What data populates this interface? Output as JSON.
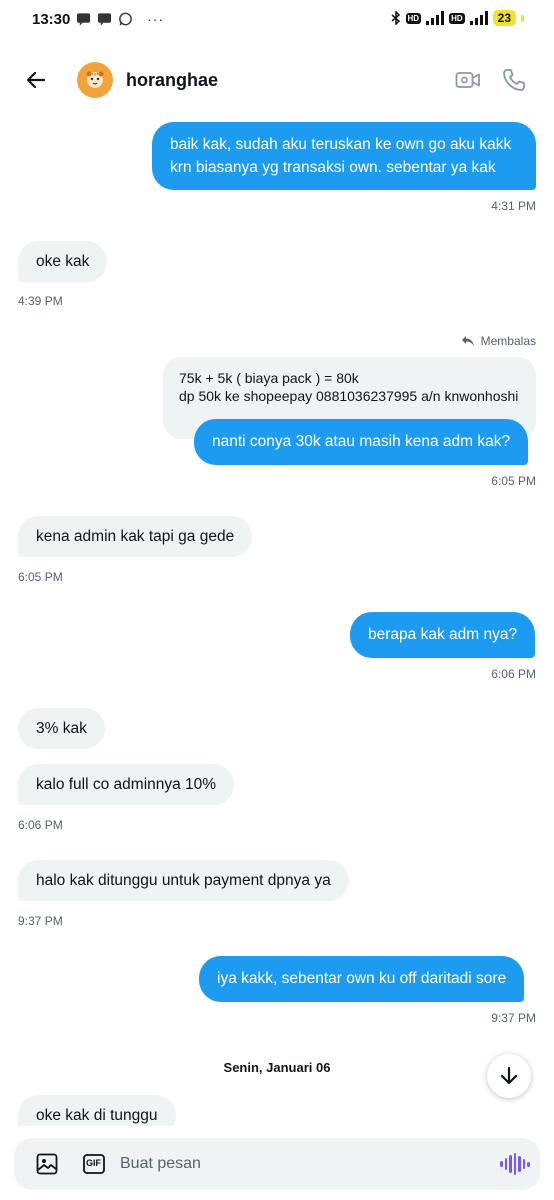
{
  "status_bar": {
    "time": "13:30",
    "dots": "···",
    "hd1": "HD",
    "hd2": "HD",
    "battery": "23"
  },
  "header": {
    "title": "horanghae"
  },
  "messages": [
    {
      "id": "m1",
      "side": "sent",
      "text": "baik kak, sudah aku teruskan ke own go aku kakk krn biasanya yg transaksi own. sebentar ya kak",
      "time": "4:31 PM"
    },
    {
      "id": "m2",
      "side": "recv",
      "text": "oke kak",
      "time": "4:39 PM"
    },
    {
      "id": "m3",
      "side": "sent",
      "text": "nanti conya 30k atau masih kena adm kak?",
      "time": "6:05 PM",
      "reply_label": "Membalas",
      "quoted": [
        "75k + 5k ( biaya pack ) = 80k",
        "dp 50k ke shopeepay 0881036237995 a/n knwonhoshi"
      ]
    },
    {
      "id": "m4",
      "side": "recv",
      "text": "kena admin kak tapi ga gede",
      "time": "6:05 PM"
    },
    {
      "id": "m5",
      "side": "sent",
      "text": "berapa kak adm nya?",
      "time": "6:06 PM"
    },
    {
      "id": "m6",
      "side": "recv",
      "text": "3% kak"
    },
    {
      "id": "m7",
      "side": "recv",
      "text": "kalo full co adminnya 10%",
      "time": "6:06 PM"
    },
    {
      "id": "m8",
      "side": "recv",
      "text": "halo kak ditunggu untuk payment dpnya ya",
      "time": "9:37 PM"
    },
    {
      "id": "m9",
      "side": "sent",
      "text": "iya kakk, sebentar own ku off daritadi sore",
      "time": "9:37 PM"
    },
    {
      "id": "m10",
      "side": "recv",
      "text": "oke kak di tunggu"
    }
  ],
  "date_separator": "Senin, Januari 06",
  "composer": {
    "placeholder": "Buat pesan",
    "gif_label": "GIF"
  },
  "colors": {
    "sent_bubble": "#1d9bf0",
    "recv_bubble": "#eff3f4",
    "voice_accent": "#7856ff",
    "avatar_bg": "#f3a33c"
  },
  "icons": [
    "back-arrow-icon",
    "video-call-icon",
    "phone-icon",
    "reply-icon",
    "arrow-down-icon",
    "image-icon",
    "gif-icon",
    "voice-icon"
  ]
}
